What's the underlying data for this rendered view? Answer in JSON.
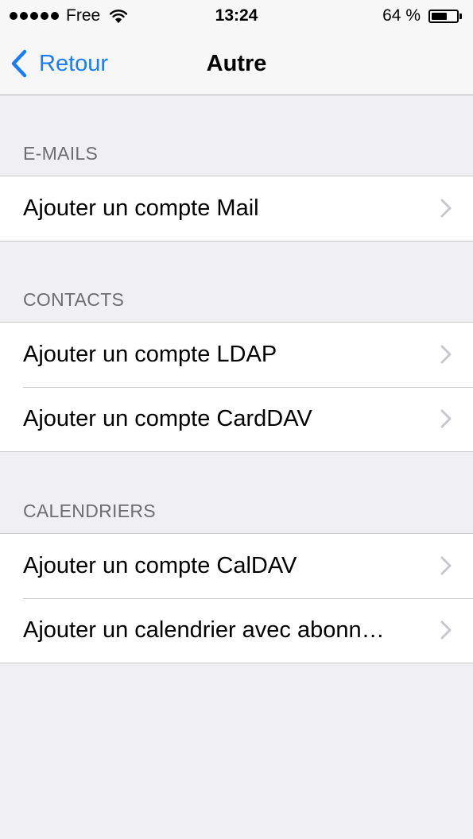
{
  "status_bar": {
    "carrier": "Free",
    "time": "13:24",
    "battery_percent": "64 %",
    "battery_level": 0.64,
    "icons": [
      "signal-dots-icon",
      "wifi-icon",
      "battery-icon"
    ]
  },
  "nav": {
    "back_label": "Retour",
    "title": "Autre"
  },
  "sections": {
    "emails": {
      "header": "E-MAILS",
      "rows": [
        "Ajouter un compte Mail"
      ]
    },
    "contacts": {
      "header": "CONTACTS",
      "rows": [
        "Ajouter un compte LDAP",
        "Ajouter un compte CardDAV"
      ]
    },
    "calendars": {
      "header": "CALENDRIERS",
      "rows": [
        "Ajouter un compte CalDAV",
        "Ajouter un calendrier avec abonn…"
      ]
    }
  },
  "colors": {
    "accent": "#1a7cf6",
    "background": "#efeff4",
    "header_text": "#6d6d72",
    "separator": "#c8c7cc",
    "chevron": "#c7c7cc"
  }
}
